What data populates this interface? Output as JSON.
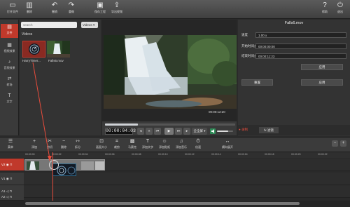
{
  "toolbar": {
    "items": [
      {
        "label": "打开文件",
        "icon": "folder-icon"
      },
      {
        "label": "删除",
        "icon": "trash-icon"
      },
      {
        "label": "撤销",
        "icon": "undo-icon"
      },
      {
        "label": "重做",
        "icon": "redo-icon"
      },
      {
        "label": "保存工程",
        "icon": "save-icon"
      },
      {
        "label": "导出视频",
        "icon": "export-icon"
      },
      {
        "label": "帮助",
        "icon": "help-icon"
      },
      {
        "label": "退出",
        "icon": "power-icon"
      }
    ]
  },
  "sidebar": {
    "items": [
      {
        "label": "文件",
        "icon": "file-icon",
        "active": true
      },
      {
        "label": "视频效果",
        "icon": "video-effect-icon",
        "active": false
      },
      {
        "label": "音频效果",
        "icon": "audio-effect-icon",
        "active": false
      },
      {
        "label": "转场",
        "icon": "transition-icon",
        "active": false
      },
      {
        "label": "文字",
        "icon": "text-icon",
        "active": false
      }
    ]
  },
  "library": {
    "search_placeholder": "search",
    "view_select": "Videos",
    "heading": "Videos",
    "items": [
      {
        "name": "HarryTimer...",
        "selected": true
      },
      {
        "name": "Falls6.mov",
        "selected": false
      }
    ]
  },
  "preview": {
    "time_total": "00:00:12:20",
    "progress": 0.25,
    "timecode": "00:00:04:03",
    "fullscreen_label": "全全屏",
    "volume": 0.7
  },
  "props": {
    "title": "Falls6.mov",
    "rows": [
      {
        "label": "速度",
        "value": "1.00 x"
      },
      {
        "label": "开始时间点",
        "value": "00:00:00:00"
      },
      {
        "label": "结束时间点",
        "value": "00:00:11:23"
      }
    ],
    "apply_label": "应用",
    "reset_label": "重置",
    "confirm_label": "应用",
    "record_label": "录制",
    "filter_label": "fx 滤镜"
  },
  "timeline_toolbar": {
    "items": [
      {
        "label": "菜单",
        "icon": "menu-icon"
      },
      {
        "label": "添加",
        "icon": "plus-icon"
      },
      {
        "label": "剪切",
        "icon": "scissors-icon"
      },
      {
        "label": "删除",
        "icon": "minus-icon"
      },
      {
        "label": "拆分",
        "icon": "split-icon"
      },
      {
        "label": "画面大小",
        "icon": "resize-icon"
      },
      {
        "label": "裁剪",
        "icon": "crop-icon"
      },
      {
        "label": "马赛克",
        "icon": "mosaic-icon"
      },
      {
        "label": "添加文字",
        "icon": "text-add-icon"
      },
      {
        "label": "添加贴纸",
        "icon": "sticker-icon"
      },
      {
        "label": "添加音乐",
        "icon": "music-icon"
      },
      {
        "label": "倍速",
        "icon": "speed-icon"
      },
      {
        "label": "横向展开",
        "icon": "expand-icon"
      }
    ]
  },
  "ruler": {
    "ticks": [
      "00:00:00",
      "00:00:02",
      "00:00:04",
      "00:00:06",
      "00:00:08",
      "00:00:10",
      "00:00:12",
      "00:00:14",
      "00:00:16",
      "00:00:18",
      "00:00:20",
      "00:00:22"
    ]
  },
  "tracks": [
    {
      "name": "V2",
      "active": true
    },
    {
      "name": "V1",
      "active": false
    },
    {
      "name": "A1",
      "active": false
    },
    {
      "name": "A2",
      "active": false
    }
  ],
  "colors": {
    "accent": "#c0392b",
    "playhead": "#e74c3c",
    "panel": "#333333"
  }
}
